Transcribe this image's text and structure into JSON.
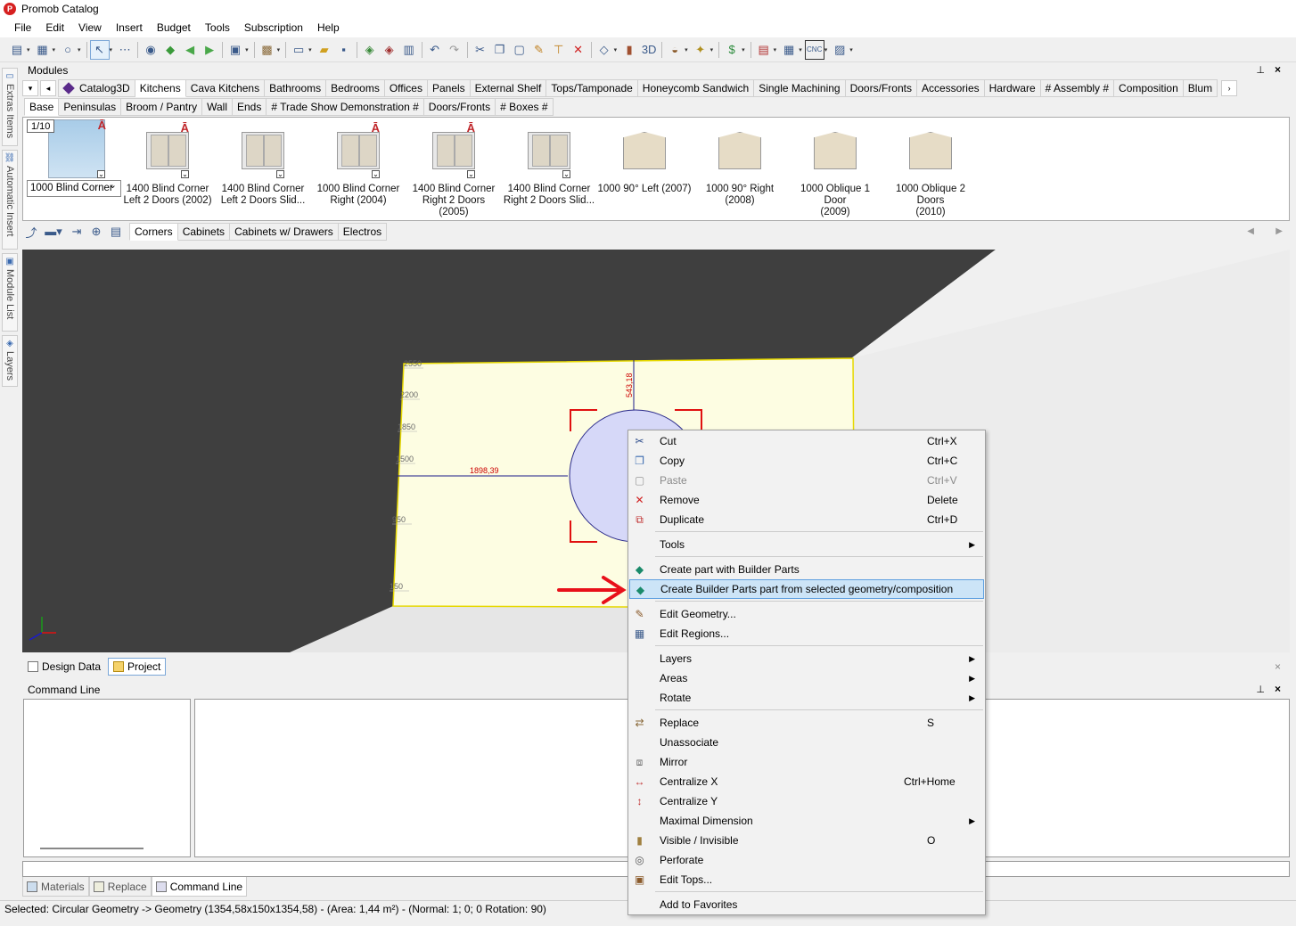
{
  "app": {
    "title": "Promob Catalog",
    "icon_letter": "P"
  },
  "menu": [
    "File",
    "Edit",
    "View",
    "Insert",
    "Budget",
    "Tools",
    "Subscription",
    "Help"
  ],
  "sidebar": [
    {
      "label": "Extras Items",
      "icon": "extras-icon"
    },
    {
      "label": "Automatic Insert",
      "icon": "automatic-insert-icon"
    },
    {
      "label": "Module List",
      "icon": "module-list-icon"
    },
    {
      "label": "Layers",
      "icon": "layers-icon"
    }
  ],
  "modules": {
    "title": "Modules",
    "pin": "⊥",
    "close": "×",
    "catalog_tab": "Catalog3D",
    "category_tabs": [
      "Kitchens",
      "Cava Kitchens",
      "Bathrooms",
      "Bedrooms",
      "Offices",
      "Panels",
      "External Shelf",
      "Tops/Tamponade",
      "Honeycomb Sandwich",
      "Single Machining",
      "Doors/Fronts",
      "Accessories",
      "Hardware",
      "# Assembly #",
      "Composition",
      "Blum"
    ],
    "sub_tabs": [
      "Base",
      "Peninsulas",
      "Broom / Pantry",
      "Wall",
      "Ends",
      "# Trade Show Demonstration #",
      "Doors/Fronts",
      "# Boxes #"
    ],
    "page_indicator": "1/10",
    "selected_item": "1000 Blind Corner",
    "items": [
      {
        "line1": "1400 Blind Corner",
        "line2": "Left 2 Doors (2002)",
        "brand": true
      },
      {
        "line1": "1400 Blind Corner",
        "line2": "Left 2 Doors Slid...",
        "brand": false
      },
      {
        "line1": "1000 Blind Corner",
        "line2": "Right (2004)",
        "brand": true
      },
      {
        "line1": "1400 Blind Corner",
        "line2": "Right 2 Doors (2005)",
        "brand": true
      },
      {
        "line1": "1400 Blind Corner",
        "line2": "Right 2 Doors Slid...",
        "brand": false
      },
      {
        "line1": "1000 90° Left (2007)",
        "line2": "",
        "brand": false
      },
      {
        "line1": "1000 90° Right",
        "line2": "(2008)",
        "brand": false
      },
      {
        "line1": "1000 Oblique 1 Door",
        "line2": "(2009)",
        "brand": false
      },
      {
        "line1": "1000 Oblique 2 Doors",
        "line2": "(2010)",
        "brand": false
      }
    ],
    "group_tabs": [
      "Corners",
      "Cabinets",
      "Cabinets w/ Drawers",
      "Electros"
    ]
  },
  "viewport": {
    "dimensions": {
      "vertical": "543,18",
      "horizontal": "1898,39"
    },
    "ruler_ticks": [
      "2550",
      "2200",
      "1850",
      "1500",
      "950",
      "150"
    ]
  },
  "bottom_tabs": [
    {
      "label": "Design Data",
      "active": false
    },
    {
      "label": "Project",
      "active": true
    }
  ],
  "command_line": {
    "title": "Command Line"
  },
  "panel_tabs": [
    {
      "label": "Materials",
      "active": false
    },
    {
      "label": "Replace",
      "active": false
    },
    {
      "label": "Command Line",
      "active": true
    }
  ],
  "status": "Selected: Circular Geometry -> Geometry (1354,58x150x1354,58) - (Area: 1,44 m²) - (Normal: 1; 0; 0 Rotation: 90)",
  "context_menu": [
    {
      "label": "Cut",
      "shortcut": "Ctrl+X",
      "icon": "cut-icon"
    },
    {
      "label": "Copy",
      "shortcut": "Ctrl+C",
      "icon": "copy-icon"
    },
    {
      "label": "Paste",
      "shortcut": "Ctrl+V",
      "icon": "paste-icon",
      "disabled": true
    },
    {
      "label": "Remove",
      "shortcut": "Delete",
      "icon": "remove-icon"
    },
    {
      "label": "Duplicate",
      "shortcut": "Ctrl+D",
      "icon": "duplicate-icon"
    },
    {
      "sep": true
    },
    {
      "label": "Tools",
      "submenu": true
    },
    {
      "sep": true
    },
    {
      "label": "Create part with Builder Parts",
      "icon": "builder-parts-icon"
    },
    {
      "label": "Create Builder Parts part from selected geometry/composition",
      "icon": "builder-parts-icon",
      "highlight": true
    },
    {
      "sep": true
    },
    {
      "label": "Edit Geometry...",
      "icon": "edit-geometry-icon"
    },
    {
      "label": "Edit Regions...",
      "icon": "edit-regions-icon"
    },
    {
      "sep": true
    },
    {
      "label": "Layers",
      "submenu": true
    },
    {
      "label": "Areas",
      "submenu": true
    },
    {
      "label": "Rotate",
      "submenu": true
    },
    {
      "sep": true
    },
    {
      "label": "Replace",
      "shortcut": "S",
      "icon": "replace-icon"
    },
    {
      "label": "Unassociate"
    },
    {
      "label": "Mirror",
      "icon": "mirror-icon"
    },
    {
      "label": "Centralize X",
      "shortcut": "Ctrl+Home",
      "icon": "centralize-x-icon",
      "wide": true
    },
    {
      "label": "Centralize Y",
      "icon": "centralize-y-icon"
    },
    {
      "label": "Maximal Dimension",
      "submenu": true
    },
    {
      "label": "Visible / Invisible",
      "shortcut": "O",
      "icon": "visible-icon"
    },
    {
      "label": "Perforate",
      "icon": "perforate-icon"
    },
    {
      "label": "Edit Tops...",
      "icon": "edit-tops-icon"
    },
    {
      "sep": true
    },
    {
      "label": "Add to Favorites"
    }
  ],
  "colors": {
    "accent": "#cce4f7",
    "highlight_border": "#5fa0e0",
    "brand_red": "#c0262a",
    "arrow_red": "#e8101a",
    "panel": "#fdfde2",
    "circle": "#d6d8f8"
  }
}
